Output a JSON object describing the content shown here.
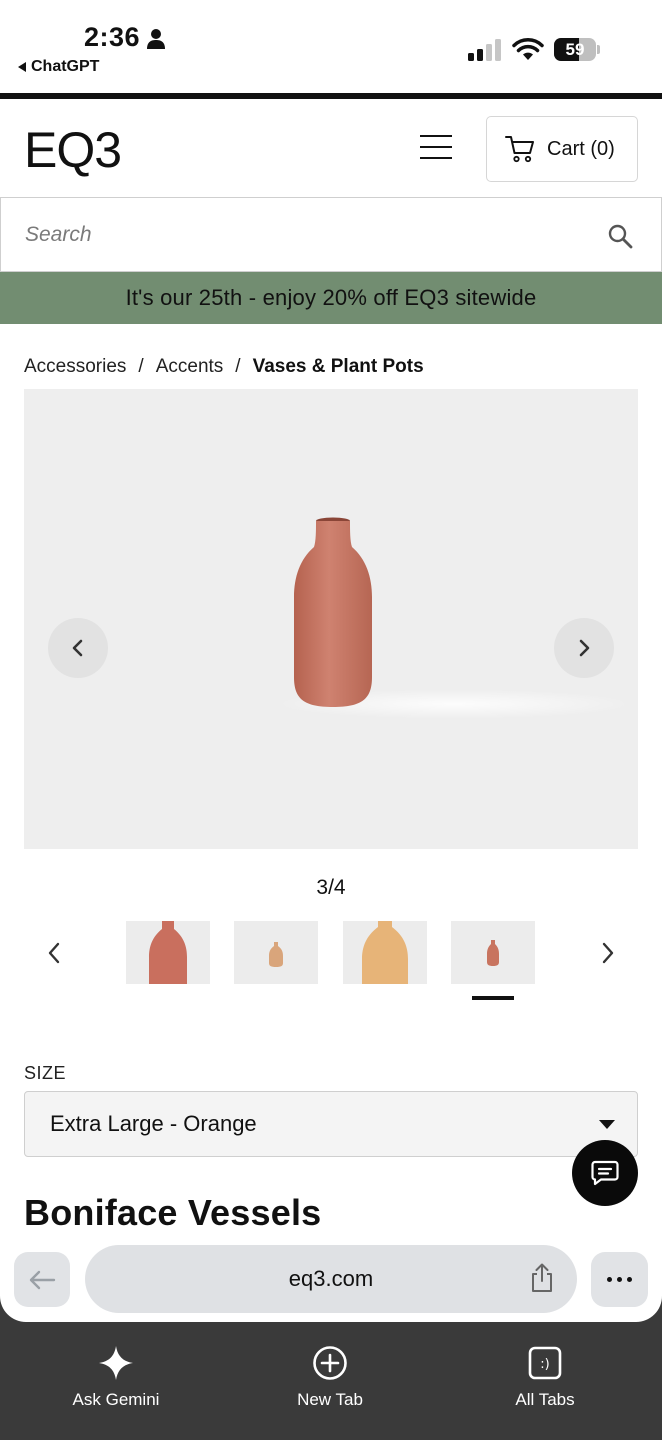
{
  "status_bar": {
    "time": "2:36",
    "back_app": "ChatGPT",
    "battery": "59",
    "battery_level": 0.59
  },
  "header": {
    "logo": "EQ3",
    "cart_label": "Cart (0)"
  },
  "search": {
    "placeholder": "Search"
  },
  "promo": {
    "text": "It's our 25th - enjoy 20% off EQ3 sitewide",
    "background": "#728d71"
  },
  "breadcrumb": {
    "items": [
      "Accessories",
      "Accents",
      "Vases & Plant Pots"
    ],
    "separator": "/"
  },
  "gallery": {
    "counter": "3/4",
    "thumbnails": [
      {
        "name": "vase-thumb-1",
        "color": "#c96f5e"
      },
      {
        "name": "vase-thumb-2",
        "color": "#d9a57b"
      },
      {
        "name": "vase-thumb-3",
        "color": "#e7b478"
      },
      {
        "name": "vase-thumb-4",
        "color": "#c8745f"
      }
    ],
    "selected_thumb": 4,
    "vase_color": "#c97a66"
  },
  "size": {
    "label": "SIZE",
    "selected": "Extra Large - Orange"
  },
  "product": {
    "title": "Boniface Vessels"
  },
  "browser": {
    "url": "eq3.com",
    "tabs": [
      {
        "label": "Ask Gemini",
        "icon": "sparkle-icon"
      },
      {
        "label": "New Tab",
        "icon": "plus-circle-icon"
      },
      {
        "label": "All Tabs",
        "icon": "tabs-icon"
      }
    ]
  }
}
